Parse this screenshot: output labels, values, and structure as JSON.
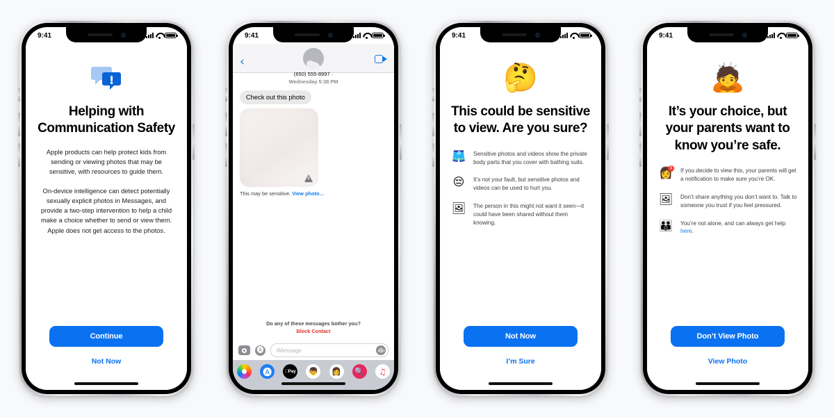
{
  "page": {
    "background": "#f8f9fb",
    "accent_blue": "#0a72f0",
    "link_blue": "#1479ea",
    "alert_red": "#e0322b"
  },
  "status_bar": {
    "time": "9:41",
    "signal_icon": "cellular-bars-icon",
    "wifi_icon": "wifi-icon",
    "battery_icon": "battery-icon"
  },
  "phones": [
    {
      "name": "communication-safety-intro",
      "hero_icon": "speech-bubbles-alert-icon",
      "title": "Helping with Communication Safety",
      "paragraphs": [
        "Apple products can help protect kids from sending or viewing photos that may be sensitive, with resources to guide them.",
        "On-device intelligence can detect potentially sexually explicit photos in Messages, and provide a two-step intervention to help a child make a choice whether to send or view them. Apple does not get access to the photos."
      ],
      "primary_button": "Continue",
      "secondary_button": "Not Now"
    },
    {
      "name": "messages-conversation",
      "back_icon": "chevron-left-icon",
      "avatar_icon": "contact-avatar-icon",
      "contact_number": "(650) 555-8997",
      "contact_chevron": "›",
      "facetime_icon": "video-camera-icon",
      "timestamp": "Wednesday 5:38 PM",
      "incoming_message": "Check out this photo",
      "photo_warning_icon": "warning-triangle-icon",
      "sensitive_prefix": "This may be sensitive.",
      "sensitive_link": "View photo…",
      "bother_question": "Do any of these messages bother you?",
      "block_contact": "Block Contact",
      "composer": {
        "camera_icon": "camera-icon",
        "appstore_icon": "app-store-icon",
        "placeholder": "iMessage",
        "audio_icon": "audio-waveform-icon"
      },
      "app_drawer": [
        {
          "name": "photos-app-icon",
          "glyph": ""
        },
        {
          "name": "app-store-app-icon",
          "glyph": "🅐"
        },
        {
          "name": "apple-pay-app-icon",
          "glyph": "Pay"
        },
        {
          "name": "memoji-boy-app-icon",
          "glyph": "👦"
        },
        {
          "name": "memoji-girl-app-icon",
          "glyph": "👩"
        },
        {
          "name": "images-search-app-icon",
          "glyph": "🔍"
        },
        {
          "name": "music-app-icon",
          "glyph": "♫"
        }
      ]
    },
    {
      "name": "sensitive-to-view-warning",
      "hero_emoji": "🤔",
      "hero_icon": "thinking-face-emoji",
      "title": "This could be sensitive to view. Are you sure?",
      "bullets": [
        {
          "emoji": "🩳",
          "icon": "swimsuit-emoji",
          "text": "Sensitive photos and videos show the private body parts that you cover with bathing suits."
        },
        {
          "emoji": "😔",
          "icon": "pensive-face-emoji",
          "text": "It’s not your fault, but sensitive photos and videos can be used to hurt you."
        },
        {
          "emoji": "🖼",
          "icon": "framed-picture-emoji",
          "text": "The person in this might not want it seen—it could have been shared without them knowing."
        }
      ],
      "primary_button": "Not Now",
      "secondary_button": "I’m Sure"
    },
    {
      "name": "parent-notification-warning",
      "hero_emoji": "🙇",
      "hero_icon": "person-bowing-emoji",
      "title": "It’s your choice, but your parents want to know you’re safe.",
      "bullets": [
        {
          "emoji": "👩",
          "icon": "memoji-notification-emoji",
          "badge": "1",
          "text": "If you decide to view this, your parents will get a notification to make sure you’re OK."
        },
        {
          "emoji": "🖼",
          "icon": "photo-share-emoji",
          "text": "Don’t share anything you don’t want to. Talk to someone you trust if you feel pressured."
        },
        {
          "emoji": "👪",
          "icon": "family-emoji",
          "text_before": "You’re not alone, and can always get help ",
          "link": "here",
          "text_after": "."
        }
      ],
      "primary_button": "Don’t View Photo",
      "secondary_button": "View Photo"
    }
  ]
}
